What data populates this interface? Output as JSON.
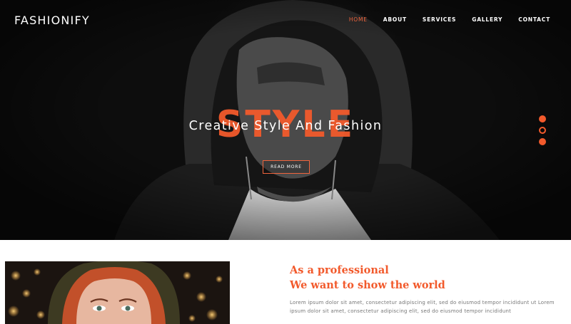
{
  "brand": {
    "logo": "FASHIONIFY",
    "accent": "#f25a2c"
  },
  "nav": {
    "items": [
      {
        "label": "HOME",
        "active": true
      },
      {
        "label": "ABOUT",
        "active": false
      },
      {
        "label": "SERVICES",
        "active": false
      },
      {
        "label": "GALLERY",
        "active": false
      },
      {
        "label": "CONTACT",
        "active": false
      }
    ]
  },
  "hero": {
    "background_word": "STYLE",
    "headline": "Creative Style And Fashion",
    "button_label": "READ MORE",
    "slides": {
      "count": 3,
      "active_index": 1
    }
  },
  "about": {
    "heading_line1": "As a professional",
    "heading_line2": "We want to show the world",
    "paragraph": "Lorem ipsum dolor sit amet, consectetur adipiscing elit, sed do eiusmod tempor incididunt ut Lorem ipsum dolor sit amet, consectetur adipiscing elit, sed do eiusmod tempor incididunt"
  }
}
